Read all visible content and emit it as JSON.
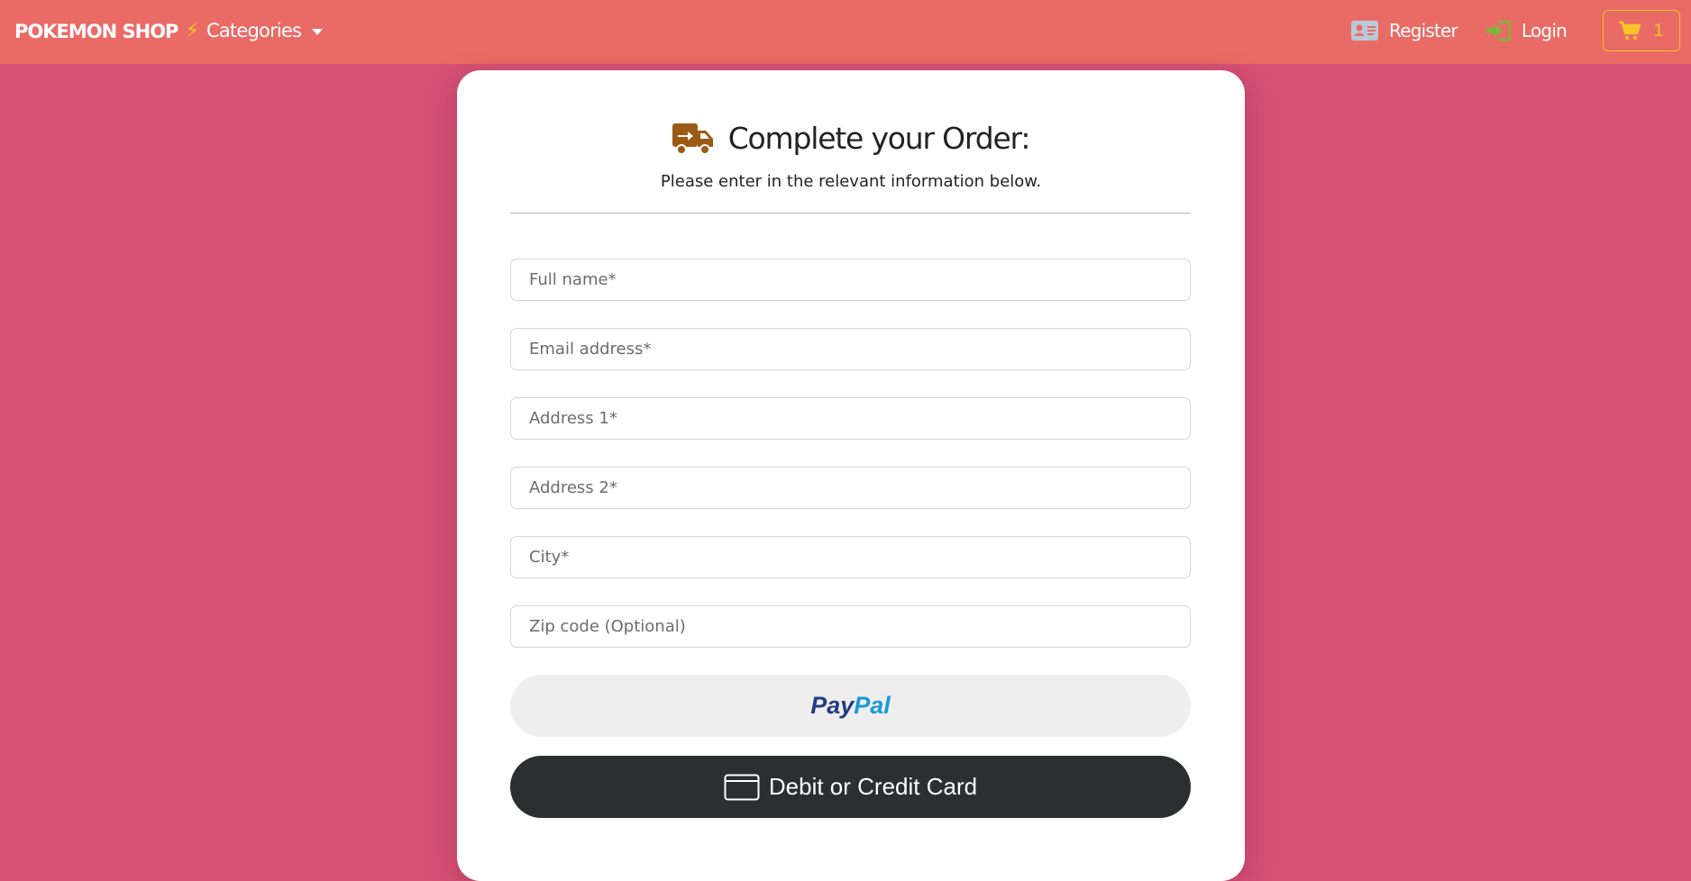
{
  "navbar": {
    "brand": "POKEMON SHOP",
    "brand_icon": "lightning-bolt-icon",
    "categories_label": "Categories",
    "register_label": "Register",
    "login_label": "Login",
    "cart_count": "1",
    "colors": {
      "background": "#ea6a65",
      "cart_accent": "#f7c52b",
      "register_icon": "#b9c9d8",
      "login_icon": "#7fb33d"
    }
  },
  "page": {
    "background": "#d55174"
  },
  "order_form": {
    "title": "Complete your Order:",
    "title_icon": "shipping-truck-icon",
    "subtitle": "Please enter in the relevant information below.",
    "fields": [
      {
        "placeholder": "Full name*",
        "value": ""
      },
      {
        "placeholder": "Email address*",
        "value": ""
      },
      {
        "placeholder": "Address 1*",
        "value": ""
      },
      {
        "placeholder": "Address 2*",
        "value": ""
      },
      {
        "placeholder": "City*",
        "value": ""
      },
      {
        "placeholder": "Zip code (Optional)",
        "value": ""
      }
    ],
    "paypal_button": {
      "part1": "Pay",
      "part2": "Pal"
    },
    "card_button": {
      "label": "Debit or Credit Card"
    },
    "colors": {
      "truck_icon": "#9b5b16",
      "paypal_dark": "#253b80",
      "paypal_light": "#179bd7",
      "card_button_bg": "#2c2e2f"
    }
  }
}
